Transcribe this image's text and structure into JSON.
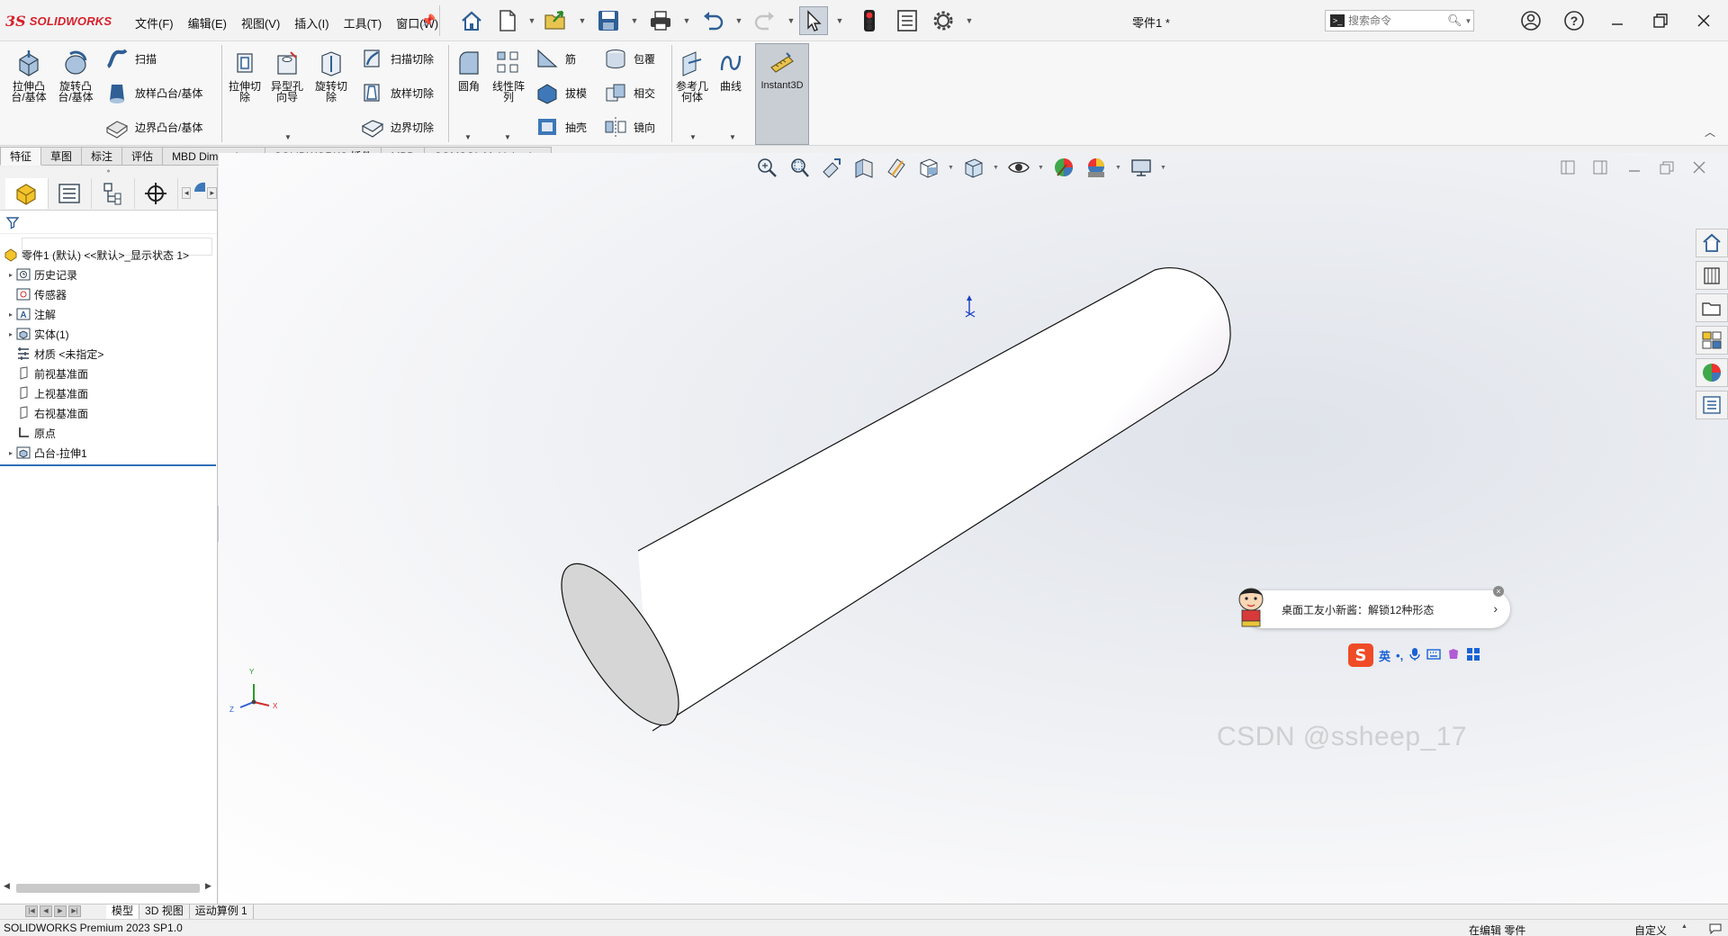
{
  "app": {
    "brand_ds": "3S",
    "brand_name": "SOLIDWORKS",
    "document_title": "零件1 *",
    "search_placeholder": "搜索命令",
    "search_prompt_icon": ">_"
  },
  "menus": [
    "文件(F)",
    "编辑(E)",
    "视图(V)",
    "插入(I)",
    "工具(T)",
    "窗口(W)"
  ],
  "toolbar_icons": [
    "home-icon",
    "new-document-icon",
    "open-icon",
    "save-icon",
    "print-icon",
    "undo-icon",
    "redo-icon",
    "select-pointer-icon",
    "rebuild-traffic-light-icon",
    "file-properties-icon",
    "options-gear-icon"
  ],
  "ribbon": {
    "extrude_boss": "拉伸凸\n台/基体",
    "revolve_boss": "旋转凸\n台/基体",
    "sweep": "扫描",
    "loft_boss": "放样凸台/基体",
    "boundary_boss": "边界凸台/基体",
    "extrude_cut": "拉伸切\n除",
    "hole_wizard": "异型孔\n向导",
    "revolve_cut": "旋转切\n除",
    "swept_cut": "扫描切除",
    "lofted_cut": "放样切除",
    "boundary_cut": "边界切除",
    "fillet": "圆角",
    "linear_pattern": "线性阵\n列",
    "rib": "筋",
    "draft": "拔模",
    "shell": "抽壳",
    "wrap": "包覆",
    "intersect": "相交",
    "mirror": "镜向",
    "ref_geometry": "参考几\n何体",
    "curves": "曲线",
    "instant3d": "Instant3D"
  },
  "cm_tabs": [
    "特征",
    "草图",
    "标注",
    "评估",
    "MBD Dimensions",
    "SOLIDWORKS 插件",
    "MBD",
    "COMSOL Multiphysics"
  ],
  "tree": {
    "root": "零件1 (默认) <<默认>_显示状态 1>",
    "items": [
      {
        "label": "历史记录",
        "expandable": true,
        "icon": "history-icon"
      },
      {
        "label": "传感器",
        "expandable": false,
        "icon": "sensor-icon"
      },
      {
        "label": "注解",
        "expandable": true,
        "icon": "annotation-icon"
      },
      {
        "label": "实体(1)",
        "expandable": true,
        "icon": "solid-bodies-icon"
      },
      {
        "label": "材质 <未指定>",
        "expandable": false,
        "icon": "material-icon"
      },
      {
        "label": "前视基准面",
        "expandable": false,
        "icon": "plane-icon"
      },
      {
        "label": "上视基准面",
        "expandable": false,
        "icon": "plane-icon"
      },
      {
        "label": "右视基准面",
        "expandable": false,
        "icon": "plane-icon"
      },
      {
        "label": "原点",
        "expandable": false,
        "icon": "origin-icon"
      },
      {
        "label": "凸台-拉伸1",
        "expandable": true,
        "icon": "boss-extrude-icon"
      }
    ]
  },
  "notification": {
    "text": "桌面工友小新酱：解锁12种形态",
    "arrow": "›",
    "close": "×"
  },
  "ime": {
    "logo": "S",
    "lang": "英",
    "punct": "•,"
  },
  "watermark": "CSDN @ssheep_17",
  "bottom_tabs": [
    "模型",
    "3D 视图",
    "运动算例 1"
  ],
  "status": {
    "product": "SOLIDWORKS Premium 2023 SP1.0",
    "editing": "在编辑 零件",
    "custom": "自定义"
  },
  "triad": {
    "x": "X",
    "y": "Y",
    "z": "Z"
  },
  "colors": {
    "brand_red": "#d6202a",
    "viewport_center": "#dfe3ea",
    "cylinder_highlight": "#e7d6ec",
    "cylinder_face": "#d6d6d6"
  }
}
